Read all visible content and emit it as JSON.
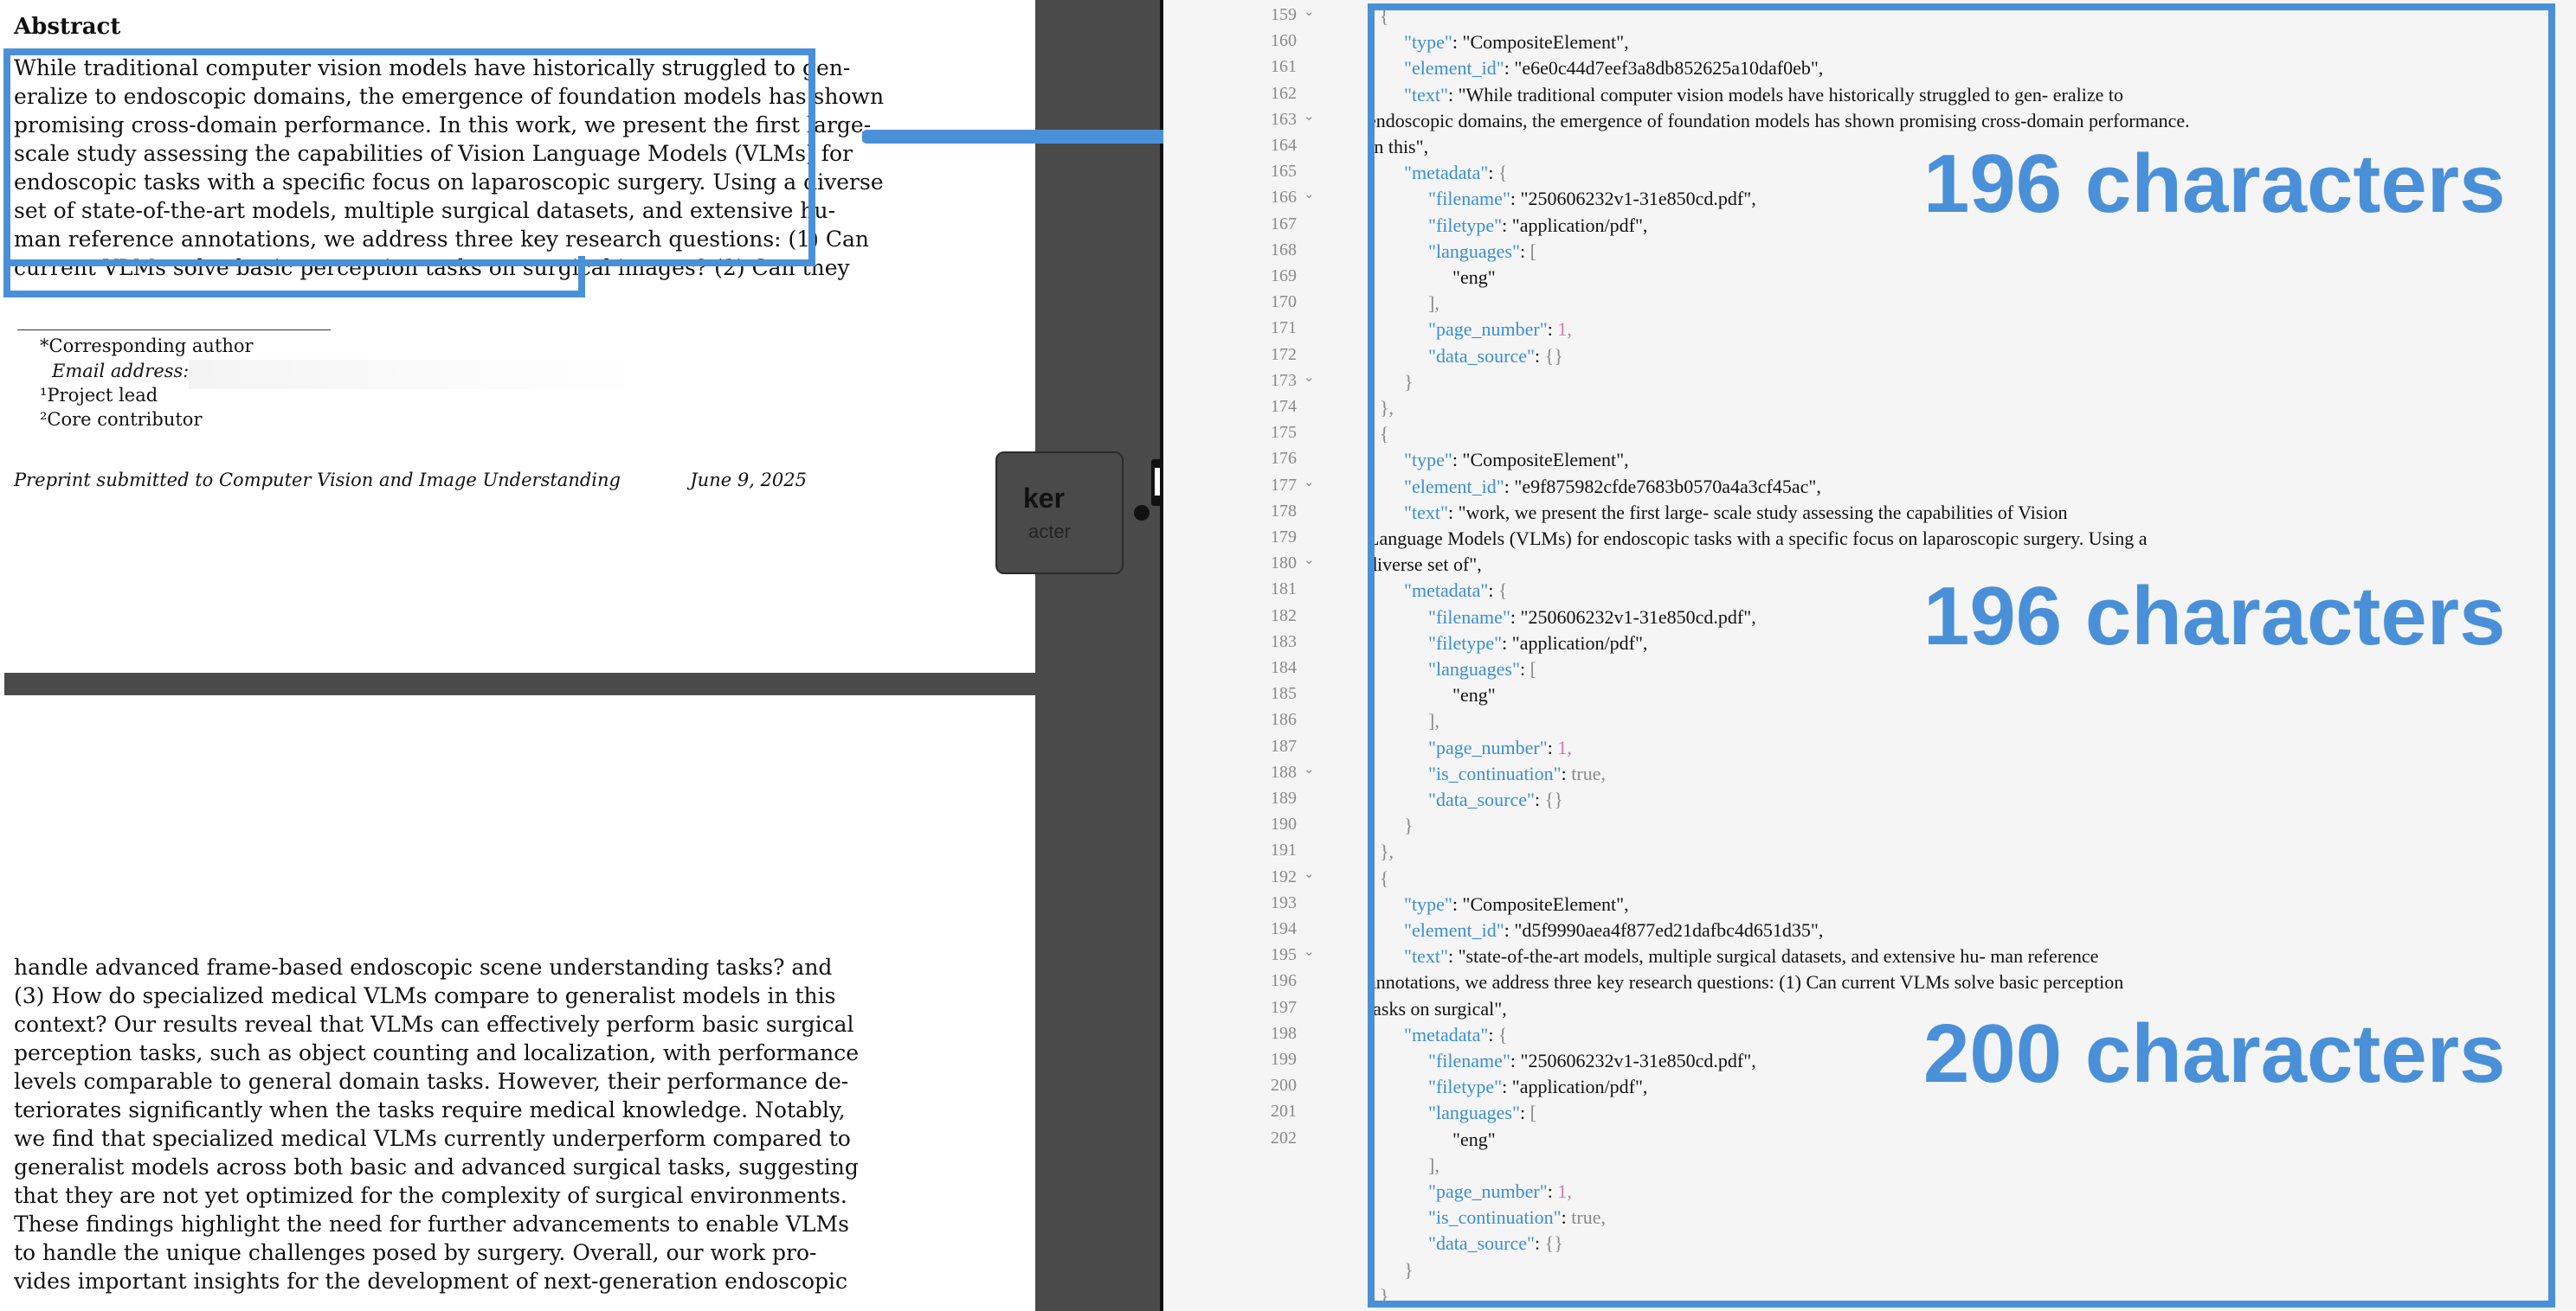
{
  "pdf": {
    "heading": "Abstract",
    "abstract_lines": [
      "While traditional computer vision models have historically struggled to gen-",
      "eralize to endoscopic domains, the emergence of foundation models has shown",
      "promising cross-domain performance. In this work, we present the first large-",
      "scale study assessing the capabilities of Vision Language Models (VLMs) for",
      "endoscopic tasks with a specific focus on laparoscopic surgery. Using a diverse",
      "set of state-of-the-art models, multiple surgical datasets, and extensive hu-",
      "man reference annotations, we address three key research questions: (1) Can",
      "current VLMs solve basic perception tasks on surgical images? (2) Can they"
    ],
    "footnotes": {
      "corresponding": "*Corresponding author",
      "email_label": "Email address:",
      "project_lead": "¹Project lead",
      "core": "²Core contributor"
    },
    "footer_journal": "Preprint submitted to Computer Vision and Image Understanding",
    "footer_date": "June 9, 2025",
    "page2_lines": [
      "handle advanced frame-based endoscopic scene understanding tasks? and",
      "(3) How do specialized medical VLMs compare to generalist models in this",
      "context? Our results reveal that VLMs can effectively perform basic surgical",
      "perception tasks, such as object counting and localization, with performance",
      "levels comparable to general domain tasks. However, their performance de-",
      "teriorates significantly when the tasks require medical knowledge. Notably,",
      "we find that specialized medical VLMs currently underperform compared to",
      "generalist models across both basic and advanced surgical tasks, suggesting",
      "that they are not yet optimized for the complexity of surgical environments.",
      "These findings highlight the need for further advancements to enable VLMs",
      "to handle the unique challenges posed by surgery. Overall, our work pro-",
      "vides important insights for the development of next-generation endoscopic"
    ]
  },
  "node": {
    "title": "ker",
    "subtitle": "acter"
  },
  "code": {
    "gutter": [
      "159",
      "160",
      "161",
      "162",
      "163",
      "164",
      "165",
      "166",
      "167",
      "168",
      "169",
      "170",
      "171",
      "172",
      "173",
      "174",
      "175",
      "176",
      "177",
      "178",
      "179",
      "180",
      "181",
      "182",
      "183",
      "184",
      "185",
      "186",
      "187",
      "188",
      "189",
      "190",
      "191",
      "192",
      "193",
      "194",
      "195",
      "196",
      "197",
      "198",
      "199",
      "200",
      "201",
      "202"
    ],
    "el1": {
      "open": "{",
      "type_key": "\"type\"",
      "type_val": "\"CompositeElement\",",
      "id_key": "\"element_id\"",
      "id_val": "\"e6e0c44d7eef3a8db852625a10daf0eb\",",
      "text_key": "\"text\"",
      "text_l1": "\"While traditional computer vision models have historically struggled to gen- eralize to",
      "text_l2": "endoscopic domains, the emergence of foundation models has shown promising cross-domain performance.",
      "text_l3": "In this\",",
      "meta_key": "\"metadata\"",
      "meta_open": "{",
      "fn_key": "\"filename\"",
      "fn_val": "\"250606232v1-31e850cd.pdf\",",
      "ft_key": "\"filetype\"",
      "ft_val": "\"application/pdf\",",
      "lang_key": "\"languages\"",
      "lang_open": "[",
      "lang_val": "\"eng\"",
      "lang_close": "],",
      "pn_key": "\"page_number\"",
      "pn_val": "1,",
      "ds_key": "\"data_source\"",
      "ds_val": "{}",
      "meta_close": "}",
      "close": "},"
    },
    "el2": {
      "open": "{",
      "type_key": "\"type\"",
      "type_val": "\"CompositeElement\",",
      "id_key": "\"element_id\"",
      "id_val": "\"e9f875982cfde7683b0570a4a3cf45ac\",",
      "text_key": "\"text\"",
      "text_l1": "\"work, we present the first large- scale study assessing the capabilities of Vision",
      "text_l2": "Language Models (VLMs) for endoscopic tasks with a specific focus on laparoscopic surgery. Using a",
      "text_l3": "diverse set of\",",
      "meta_key": "\"metadata\"",
      "meta_open": "{",
      "fn_key": "\"filename\"",
      "fn_val": "\"250606232v1-31e850cd.pdf\",",
      "ft_key": "\"filetype\"",
      "ft_val": "\"application/pdf\",",
      "lang_key": "\"languages\"",
      "lang_open": "[",
      "lang_val": "\"eng\"",
      "lang_close": "],",
      "pn_key": "\"page_number\"",
      "pn_val": "1,",
      "ic_key": "\"is_continuation\"",
      "ic_val": "true,",
      "ds_key": "\"data_source\"",
      "ds_val": "{}",
      "meta_close": "}",
      "close": "},"
    },
    "el3": {
      "open": "{",
      "type_key": "\"type\"",
      "type_val": "\"CompositeElement\",",
      "id_key": "\"element_id\"",
      "id_val": "\"d5f9990aea4f877ed21dafbc4d651d35\",",
      "text_key": "\"text\"",
      "text_l1": "\"state-of-the-art models, multiple surgical datasets, and extensive hu- man reference",
      "text_l2": "annotations, we address three key research questions: (1) Can current VLMs solve basic perception",
      "text_l3": "tasks on surgical\",",
      "meta_key": "\"metadata\"",
      "meta_open": "{",
      "fn_key": "\"filename\"",
      "fn_val": "\"250606232v1-31e850cd.pdf\",",
      "ft_key": "\"filetype\"",
      "ft_val": "\"application/pdf\",",
      "lang_key": "\"languages\"",
      "lang_open": "[",
      "lang_val": "\"eng\"",
      "lang_close": "],",
      "pn_key": "\"page_number\"",
      "pn_val": "1,",
      "ic_key": "\"is_continuation\"",
      "ic_val": "true,",
      "ds_key": "\"data_source\"",
      "ds_val": "{}",
      "meta_close": "}",
      "close": "}"
    }
  },
  "annotations": [
    "196 characters",
    "196 characters",
    "200 characters"
  ],
  "colors": {
    "accent": "#4a90d9",
    "json_key": "#3b8fcf",
    "number": "#d07ab0",
    "dark_panel": "#4a4a4a"
  },
  "icons": [
    "fold-chevron-icon",
    "arrow-icon"
  ]
}
